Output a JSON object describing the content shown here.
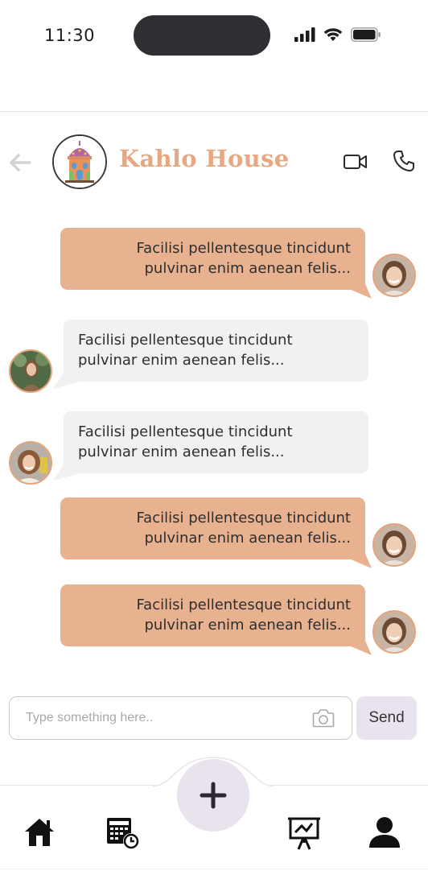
{
  "status_bar": {
    "time": "11:30"
  },
  "header": {
    "title": "Kahlo House",
    "back_icon": "arrow-left-icon",
    "video_icon": "video-camera-icon",
    "phone_icon": "phone-icon"
  },
  "messages": [
    {
      "direction": "outgoing",
      "line1": "Facilisi pellentesque tincidunt",
      "line2": "pulvinar enim aenean felis...",
      "avatar": "avatar-me"
    },
    {
      "direction": "incoming",
      "line1": "Facilisi pellentesque tincidunt",
      "line2": "pulvinar enim aenean felis...",
      "avatar": "avatar-member-1"
    },
    {
      "direction": "incoming",
      "line1": "Facilisi pellentesque tincidunt",
      "line2": "pulvinar enim aenean felis...",
      "avatar": "avatar-member-2"
    },
    {
      "direction": "outgoing",
      "line1": "Facilisi pellentesque tincidunt",
      "line2": "pulvinar enim aenean felis...",
      "avatar": "avatar-me"
    },
    {
      "direction": "outgoing",
      "line1": "Facilisi pellentesque tincidunt",
      "line2": "pulvinar enim aenean felis...",
      "avatar": "avatar-me"
    }
  ],
  "composer": {
    "placeholder": "Type something here..",
    "send_label": "Send",
    "camera_icon": "camera-icon"
  },
  "bottom_nav": {
    "items": [
      {
        "icon": "home-icon"
      },
      {
        "icon": "calendar-clock-icon"
      },
      {
        "icon": "add-icon"
      },
      {
        "icon": "presentation-board-icon"
      },
      {
        "icon": "profile-icon"
      }
    ]
  },
  "colors": {
    "accent": "#e6a882",
    "outgoing_bubble": "#e8b18f",
    "incoming_bubble": "#f1f1f1",
    "lavender": "#e9e3ee"
  }
}
